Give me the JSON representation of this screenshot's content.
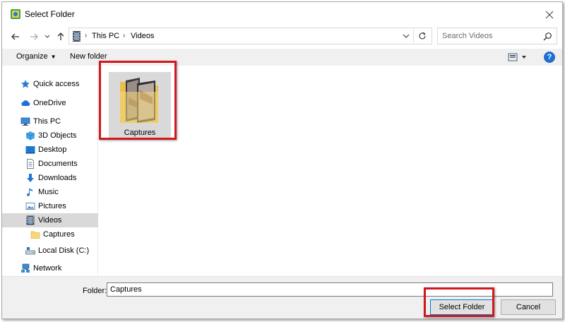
{
  "window": {
    "title": "Select Folder"
  },
  "address": {
    "crumbs": [
      "This PC",
      "Videos"
    ]
  },
  "search": {
    "placeholder": "Search Videos"
  },
  "toolbar": {
    "organize_label": "Organize",
    "new_folder_label": "New folder",
    "help_label": "?"
  },
  "sidebar": {
    "items": [
      {
        "label": "Quick access",
        "icon": "star-pin-icon"
      },
      {
        "label": "OneDrive",
        "icon": "cloud-icon"
      },
      {
        "label": "This PC",
        "icon": "computer-icon"
      },
      {
        "label": "3D Objects",
        "icon": "cube-icon"
      },
      {
        "label": "Desktop",
        "icon": "desktop-icon"
      },
      {
        "label": "Documents",
        "icon": "document-icon"
      },
      {
        "label": "Downloads",
        "icon": "download-arrow-icon"
      },
      {
        "label": "Music",
        "icon": "music-note-icon"
      },
      {
        "label": "Pictures",
        "icon": "picture-icon"
      },
      {
        "label": "Videos",
        "icon": "film-icon",
        "selected": true
      },
      {
        "label": "Captures",
        "icon": "folder-icon"
      },
      {
        "label": "Local Disk (C:)",
        "icon": "drive-icon"
      },
      {
        "label": "Network",
        "icon": "network-icon"
      }
    ]
  },
  "content": {
    "folders": [
      {
        "name": "Captures",
        "icon": "folder-thumbnail-icon"
      }
    ]
  },
  "bottom": {
    "folder_caption": "Folder:",
    "folder_value": "Captures",
    "select_label": "Select Folder",
    "cancel_label": "Cancel"
  },
  "colors": {
    "highlight": "#d0191c",
    "selection": "#d9d9d9",
    "accent": "#0078d7"
  }
}
